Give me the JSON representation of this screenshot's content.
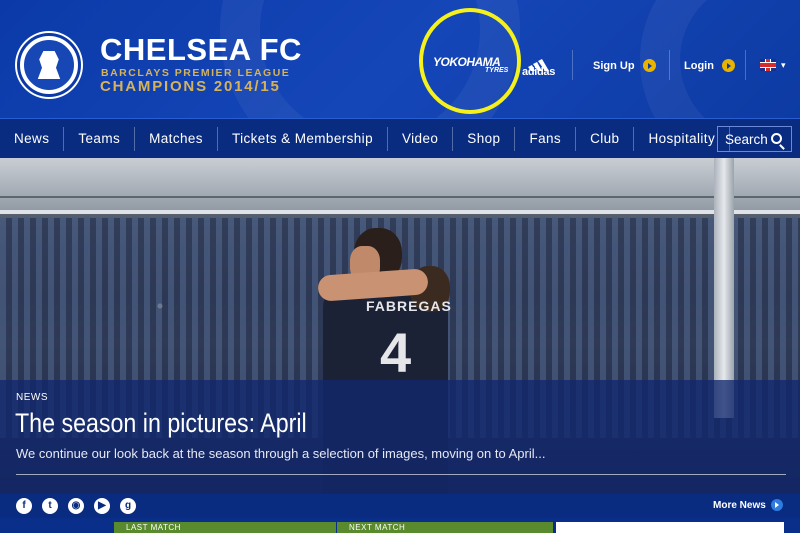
{
  "header": {
    "club_name": "CHELSEA FC",
    "subtitle_line1": "BARCLAYS PREMIER LEAGUE",
    "subtitle_line2": "CHAMPIONS 2014/15",
    "sponsor1": "YOKOHAMA",
    "sponsor1_sub": "TYRES",
    "sponsor2": "adidas",
    "signup_label": "Sign Up",
    "login_label": "Login",
    "language": "GB"
  },
  "nav": {
    "items": [
      "News",
      "Teams",
      "Matches",
      "Tickets & Membership",
      "Video",
      "Shop",
      "Fans",
      "Club",
      "Hospitality"
    ],
    "search_label": "Search"
  },
  "hero": {
    "tag": "NEWS",
    "title": "The season in pictures: April",
    "description": "We continue our look back at the season through a selection of images, moving on to April...",
    "player_name": "FABREGAS",
    "player_number": "4"
  },
  "social": {
    "icons": [
      "facebook-icon",
      "twitter-icon",
      "instagram-icon",
      "youtube-icon",
      "google-plus-icon"
    ],
    "more_news_label": "More News"
  },
  "matches": {
    "last_match_label": "LAST MATCH",
    "next_match_label": "NEXT MATCH"
  },
  "colors": {
    "brand_blue": "#0b3aa8",
    "nav_blue": "#0a2c80",
    "gold": "#d4b35c",
    "highlight_ring": "#f4f11c",
    "cta_yellow": "#e8b400"
  }
}
